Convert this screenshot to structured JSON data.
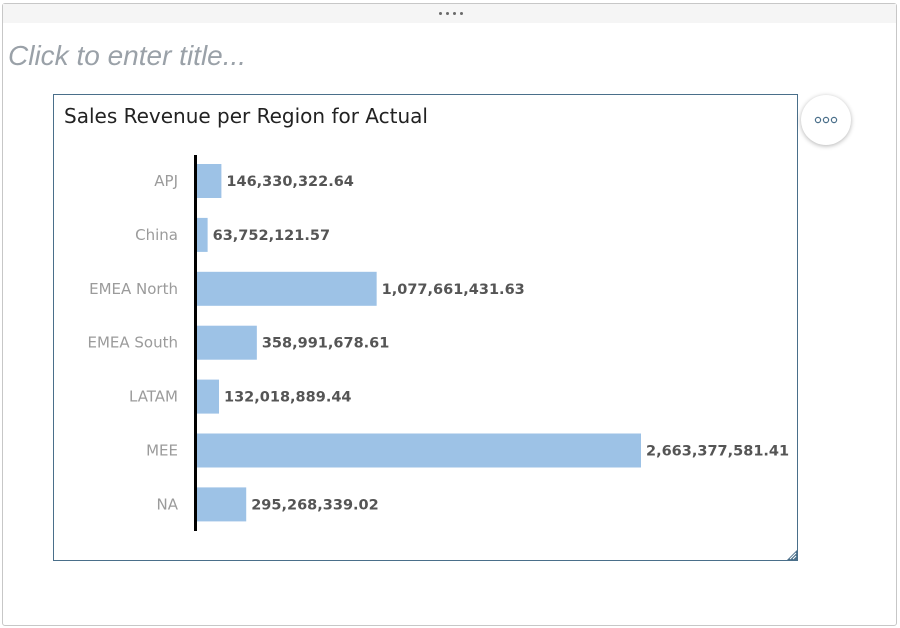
{
  "page": {
    "title_placeholder": "Click to enter title..."
  },
  "widget": {
    "more_icon": "more-horizontal-icon",
    "drag_icon": "drag-handle-icon",
    "resize_icon": "resize-corner-icon"
  },
  "colors": {
    "bar": "#9dc2e6",
    "axis": "#000000",
    "accent": "#4a6f8a"
  },
  "chart_data": {
    "type": "bar",
    "orientation": "horizontal",
    "title": "Sales Revenue per Region for Actual",
    "categories": [
      "APJ",
      "China",
      "EMEA North",
      "EMEA South",
      "LATAM",
      "MEE",
      "NA"
    ],
    "values": [
      146330322.64,
      63752121.57,
      1077661431.63,
      358991678.61,
      132018889.44,
      2663377581.41,
      295268339.02
    ],
    "value_labels": [
      "146,330,322.64",
      "63,752,121.57",
      "1,077,661,431.63",
      "358,991,678.61",
      "132,018,889.44",
      "2,663,377,581.41",
      "295,268,339.02"
    ],
    "xlim": [
      0,
      2663377581.41
    ],
    "grid": false,
    "legend": "none"
  }
}
